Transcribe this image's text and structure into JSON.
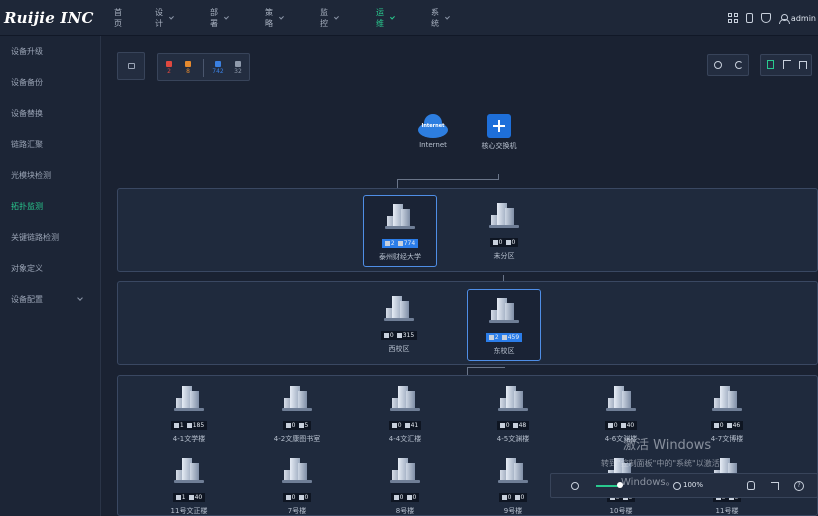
{
  "brand": "Ruijie INC",
  "topnav": [
    {
      "label": "首页",
      "has_chevron": false,
      "active": false
    },
    {
      "label": "设计",
      "has_chevron": true,
      "active": false
    },
    {
      "label": "部署",
      "has_chevron": true,
      "active": false
    },
    {
      "label": "策略",
      "has_chevron": true,
      "active": false
    },
    {
      "label": "监控",
      "has_chevron": true,
      "active": false
    },
    {
      "label": "运维",
      "has_chevron": true,
      "active": true
    },
    {
      "label": "系统",
      "has_chevron": true,
      "active": false
    }
  ],
  "user": {
    "name": "admin",
    "icons": [
      "grid-icon",
      "phone-icon",
      "shield-icon",
      "user-icon"
    ]
  },
  "sidebar": [
    {
      "label": "设备升级",
      "active": false
    },
    {
      "label": "设备备份",
      "active": false
    },
    {
      "label": "设备替换",
      "active": false
    },
    {
      "label": "链路汇聚",
      "active": false
    },
    {
      "label": "光模块检测",
      "active": false
    },
    {
      "label": "拓扑监测",
      "active": true
    },
    {
      "label": "关键链路检测",
      "active": false
    },
    {
      "label": "对象定义",
      "active": false
    },
    {
      "label": "设备配置",
      "active": false,
      "has_chevron": true
    }
  ],
  "stats": {
    "red": {
      "value": "2",
      "color": "#e0483f"
    },
    "orange": {
      "value": "8",
      "color": "#e68a2e"
    },
    "blue": {
      "value": "742",
      "color": "#3a7fe0"
    },
    "gray": {
      "value": "32",
      "color": "#8f9aab"
    }
  },
  "topology": {
    "core": [
      {
        "label": "Internet",
        "cloud_text": "Internet"
      },
      {
        "label": "核心交换机"
      }
    ],
    "level1": [
      {
        "label": "泰州财经大学",
        "a": "2",
        "b": "774",
        "highlight": true
      },
      {
        "label": "未分区",
        "a": "0",
        "b": "0",
        "highlight": false
      }
    ],
    "level2": [
      {
        "label": "西校区",
        "a": "0",
        "b": "315",
        "highlight": false
      },
      {
        "label": "东校区",
        "a": "2",
        "b": "459",
        "highlight": true
      }
    ],
    "level3": [
      {
        "label": "4-1文学楼",
        "a": "1",
        "b": "185"
      },
      {
        "label": "4-2文康图书室",
        "a": "0",
        "b": "5"
      },
      {
        "label": "4-4文汇楼",
        "a": "0",
        "b": "41"
      },
      {
        "label": "4-5文渊楼",
        "a": "0",
        "b": "48"
      },
      {
        "label": "4-6文渊楼",
        "a": "0",
        "b": "40"
      },
      {
        "label": "4-7文博楼",
        "a": "0",
        "b": "46"
      },
      {
        "label": "11号文正楼",
        "a": "1",
        "b": "40"
      },
      {
        "label": "7号楼",
        "a": "0",
        "b": "0"
      },
      {
        "label": "8号楼",
        "a": "0",
        "b": "0"
      },
      {
        "label": "9号楼",
        "a": "0",
        "b": "0"
      },
      {
        "label": "10号楼",
        "a": "0",
        "b": "0"
      },
      {
        "label": "11号楼",
        "a": "0",
        "b": "0"
      }
    ]
  },
  "zoom": {
    "value": "100%"
  },
  "watermark": {
    "line1": "激活 Windows",
    "line2": "转到\"控制面板\"中的\"系统\"以激活",
    "line3": "Windows。"
  }
}
